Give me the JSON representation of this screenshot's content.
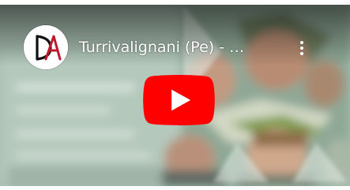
{
  "video": {
    "title": "Turrivalignani (Pe) - …",
    "channel_logo": "DA monogram logo",
    "play_icon": "youtube-play-icon",
    "more_icon": "more-vert-icon"
  },
  "colors": {
    "play_button": "#ff0000",
    "title_text": "#ffffff"
  }
}
